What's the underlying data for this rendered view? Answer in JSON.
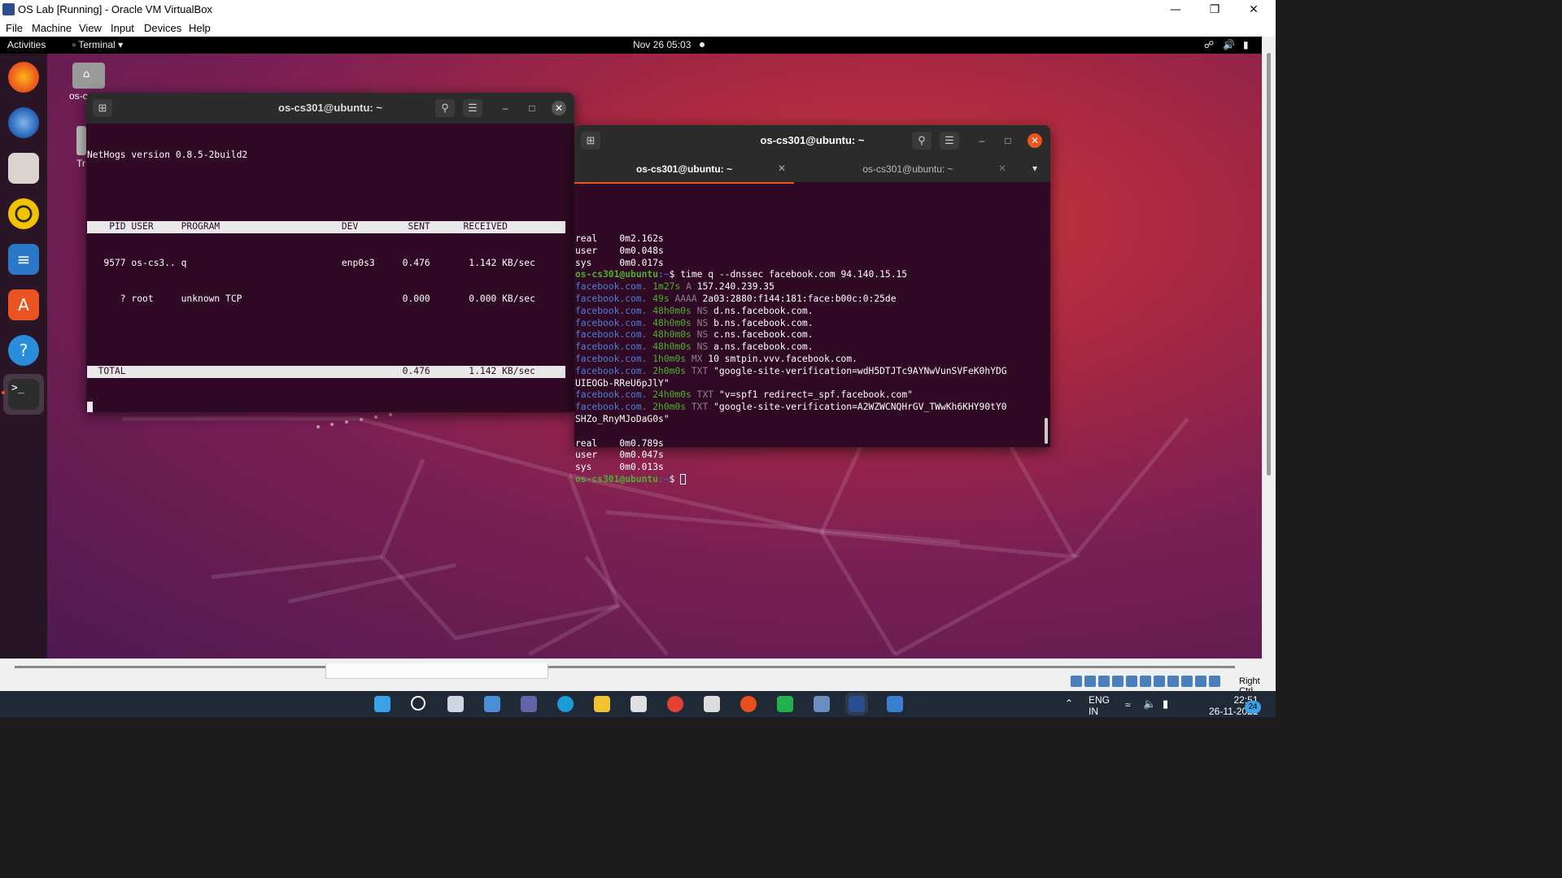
{
  "vbox": {
    "title": "OS Lab [Running] - Oracle VM VirtualBox",
    "menu": [
      "File",
      "Machine",
      "View",
      "Input",
      "Devices",
      "Help"
    ],
    "right_ctrl": "Right Ctrl"
  },
  "gnome": {
    "activities": "Activities",
    "app_menu": "Terminal",
    "clock": "Nov 26  05:03"
  },
  "desktop": {
    "home_label": "os-c",
    "trash_label": "Tr"
  },
  "term1": {
    "title": "os-cs301@ubuntu: ~",
    "lines": [
      "NetHogs version 0.8.5-2build2",
      "",
      "    PID USER     PROGRAM                      DEV         SENT      RECEIVED       ",
      "   9577 os-cs3.. q                            enp0s3     0.476       1.142 KB/sec",
      "      ? root     unknown TCP                             0.000       0.000 KB/sec",
      "",
      "  TOTAL                                                  0.476       1.142 KB/sec "
    ]
  },
  "term2": {
    "title": "os-cs301@ubuntu: ~",
    "tabs": [
      "os-cs301@ubuntu: ~",
      "os-cs301@ubuntu: ~"
    ],
    "out1": [
      "real\t0m2.162s",
      "user\t0m0.048s",
      "sys\t0m0.017s"
    ],
    "prompt_user": "os-cs301@ubuntu",
    "prompt_path": ":~",
    "command": "$ time q --dnssec facebook.com 94.140.15.15",
    "records": [
      {
        "name": "facebook.com.",
        "ttl": "1m27s",
        "type": "A",
        "value": "157.240.239.35"
      },
      {
        "name": "facebook.com.",
        "ttl": "49s",
        "type": "AAAA",
        "value": "2a03:2880:f144:181:face:b00c:0:25de"
      },
      {
        "name": "facebook.com.",
        "ttl": "48h0m0s",
        "type": "NS",
        "value": "d.ns.facebook.com."
      },
      {
        "name": "facebook.com.",
        "ttl": "48h0m0s",
        "type": "NS",
        "value": "b.ns.facebook.com."
      },
      {
        "name": "facebook.com.",
        "ttl": "48h0m0s",
        "type": "NS",
        "value": "c.ns.facebook.com."
      },
      {
        "name": "facebook.com.",
        "ttl": "48h0m0s",
        "type": "NS",
        "value": "a.ns.facebook.com."
      },
      {
        "name": "facebook.com.",
        "ttl": "1h0m0s",
        "type": "MX",
        "value": "10 smtpin.vvv.facebook.com."
      },
      {
        "name": "facebook.com.",
        "ttl": "2h0m0s",
        "type": "TXT",
        "value": "\"google-site-verification=wdH5DTJTc9AYNwVunSVFeK0hYDG",
        "wrap": "UIEOGb-RReU6pJlY\""
      },
      {
        "name": "facebook.com.",
        "ttl": "24h0m0s",
        "type": "TXT",
        "value": "\"v=spf1 redirect=_spf.facebook.com\""
      },
      {
        "name": "facebook.com.",
        "ttl": "2h0m0s",
        "type": "TXT",
        "value": "\"google-site-verification=A2WZWCNQHrGV_TWwKh6KHY90tY0",
        "wrap": "SHZo_RnyMJoDaG0s\""
      }
    ],
    "out2": [
      "real\t0m0.789s",
      "user\t0m0.047s",
      "sys\t0m0.013s"
    ],
    "final_prompt": "$ "
  },
  "taskbar": {
    "lang": "ENG",
    "lang2": "IN",
    "time": "22:51",
    "date": "26-11-2021",
    "badge": "24"
  }
}
